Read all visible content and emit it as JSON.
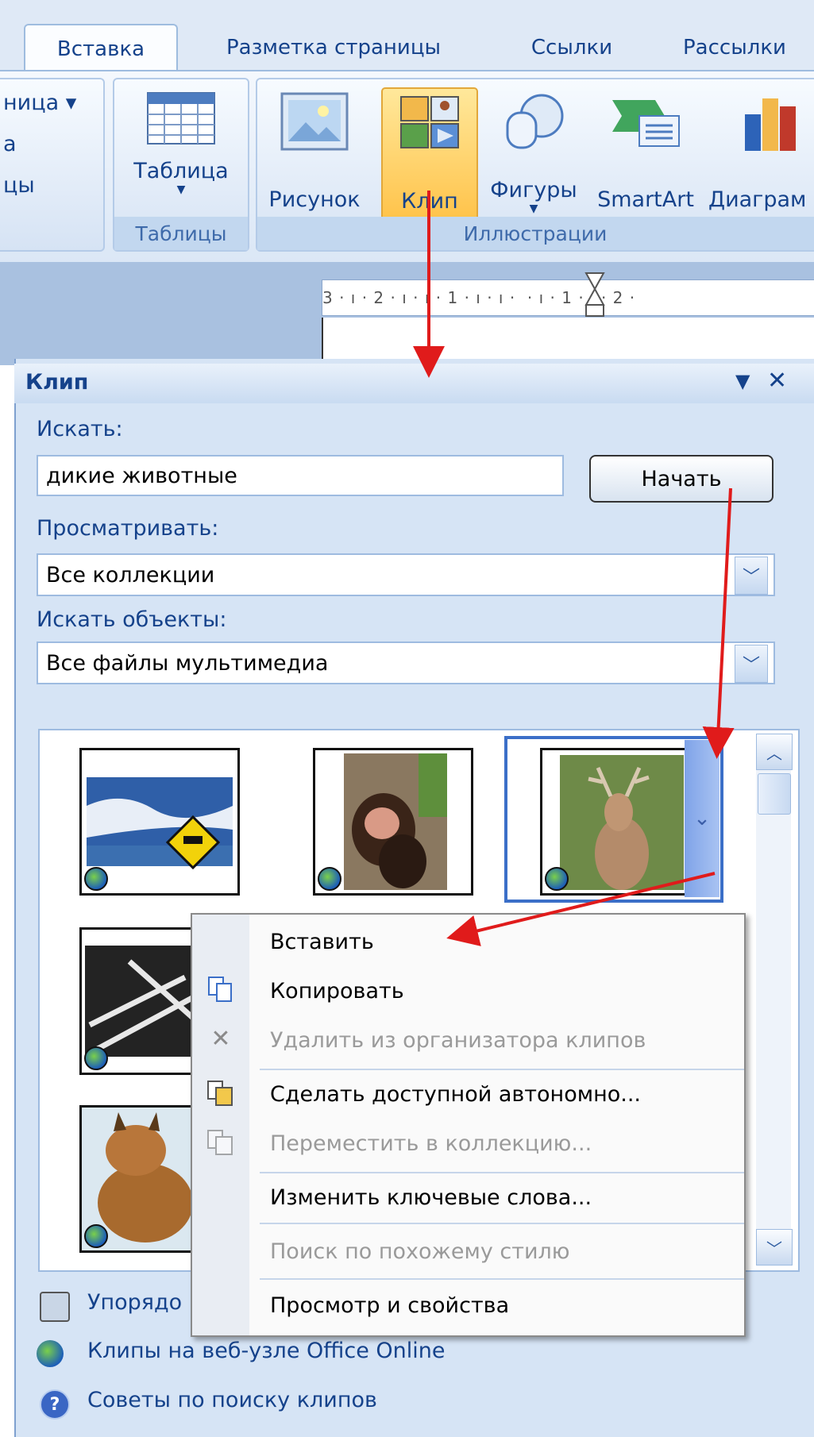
{
  "ribbon": {
    "tabs": [
      {
        "label": "Вставка",
        "active": true
      },
      {
        "label": "Разметка страницы",
        "active": false
      },
      {
        "label": "Ссылки",
        "active": false
      },
      {
        "label": "Рассылки",
        "active": false
      }
    ],
    "left_fragments": [
      "ница ▾",
      "а",
      "цы"
    ],
    "groups": {
      "tables": {
        "label": "Таблицы",
        "button_label": "Таблица"
      },
      "illustrations": {
        "label": "Иллюстрации",
        "buttons": [
          "Рисунок",
          "Клип",
          "Фигуры",
          "SmartArt",
          "Диаграм"
        ]
      }
    }
  },
  "ruler": {
    "text": "3 · ı · 2 · ı · ı · 1 · ı · ı ·  · ı · 1 · ı · 2 ·"
  },
  "pane": {
    "title": "Клип",
    "search_label": "Искать:",
    "search_value": "дикие животные",
    "go_button": "Начать",
    "browse_label": "Просматривать:",
    "browse_value": "Все коллекции",
    "types_label": "Искать объекты:",
    "types_value": "Все файлы мультимедиа",
    "links": [
      {
        "label": "Упорядо",
        "icon": "organize-icon"
      },
      {
        "label": "Клипы на веб-узле Office Online",
        "icon": "office-online-icon"
      },
      {
        "label": "Советы по поиску клипов",
        "icon": "help-icon"
      }
    ]
  },
  "context_menu": {
    "items": [
      {
        "label": "Вставить",
        "enabled": true,
        "icon": ""
      },
      {
        "label": "Копировать",
        "enabled": true,
        "icon": "copy-icon"
      },
      {
        "label": "Удалить из организатора клипов",
        "enabled": false,
        "icon": "delete-icon"
      },
      {
        "label": "Сделать доступной автономно...",
        "enabled": true,
        "icon": "offline-icon"
      },
      {
        "label": "Переместить в коллекцию...",
        "enabled": false,
        "icon": "move-icon"
      },
      {
        "label": "Изменить ключевые слова...",
        "enabled": true,
        "icon": ""
      },
      {
        "label": "Поиск по похожему стилю",
        "enabled": false,
        "icon": ""
      },
      {
        "label": "Просмотр и свойства",
        "enabled": true,
        "icon": ""
      }
    ]
  },
  "colors": {
    "annotation_arrow": "#e01b1b",
    "link_text": "#15428b",
    "pane_bg": "#d6e4f5"
  }
}
